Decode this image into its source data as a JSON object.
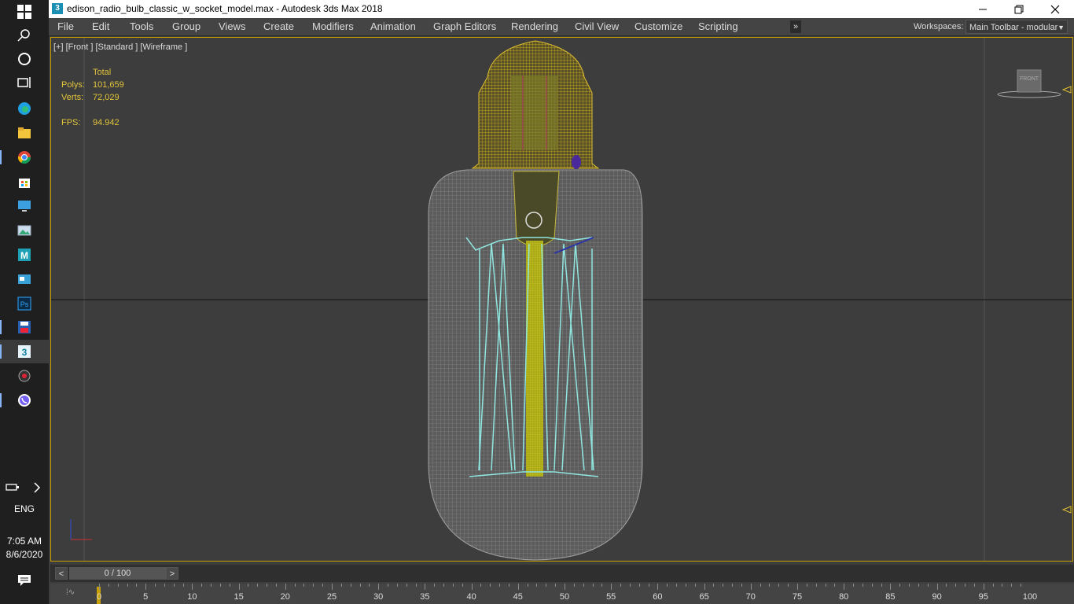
{
  "window": {
    "title": "edison_radio_bulb_classic_w_socket_model.max - Autodesk 3ds Max 2018",
    "app_icon": "3"
  },
  "menu": {
    "items": [
      "File",
      "Edit",
      "Tools",
      "Group",
      "Views",
      "Create",
      "Modifiers",
      "Animation",
      "Graph Editors",
      "Rendering",
      "Civil View",
      "Customize",
      "Scripting"
    ],
    "overflow": "»"
  },
  "workspace": {
    "label": "Workspaces:",
    "selected": "Main Toolbar - modular"
  },
  "viewport": {
    "label": "[+] [Front ] [Standard ] [Wireframe ]",
    "viewcube_face": "FRONT",
    "stats": {
      "header": "Total",
      "polys_label": "Polys:",
      "polys_value": "101,659",
      "verts_label": "Verts:",
      "verts_value": "72,029",
      "fps_label": "FPS:",
      "fps_value": "94.942"
    }
  },
  "timeline": {
    "frame_display": "0 / 100",
    "prev": "<",
    "next": ">",
    "ticks": [
      "0",
      "5",
      "10",
      "15",
      "20",
      "25",
      "30",
      "35",
      "40",
      "45",
      "50",
      "55",
      "60",
      "65",
      "70",
      "75",
      "80",
      "85",
      "90",
      "95",
      "100"
    ]
  },
  "taskbar": {
    "language": "ENG",
    "time": "7:05 AM",
    "date": "8/6/2020"
  }
}
